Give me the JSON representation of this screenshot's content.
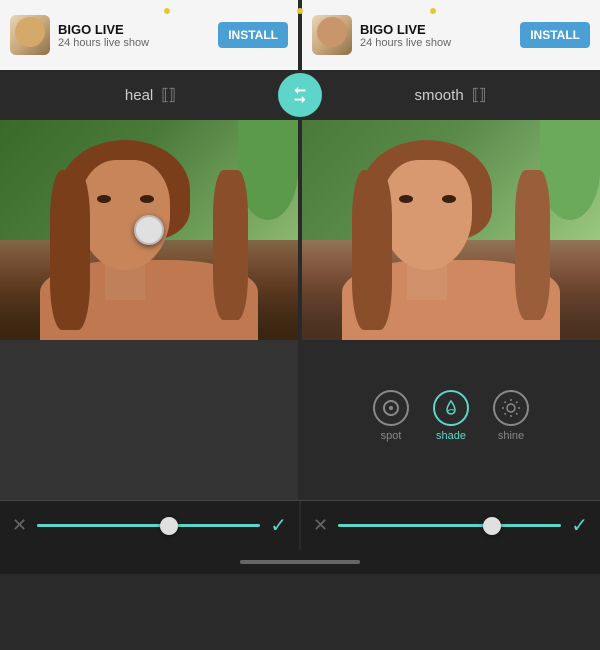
{
  "ads": {
    "left": {
      "title": "BIGO LIVE",
      "subtitle": "24 hours live show",
      "install_label": "INSTALL"
    },
    "right": {
      "title": "BIGO LIVE",
      "subtitle": "24 hours live show",
      "install_label": "INSTALL"
    }
  },
  "filters": {
    "left_label": "heal",
    "right_label": "smooth",
    "toggle_icon": "compare-icon"
  },
  "tools": {
    "items": [
      {
        "id": "spot",
        "label": "spot",
        "active": false
      },
      {
        "id": "shade",
        "label": "shade",
        "active": true
      },
      {
        "id": "shine",
        "label": "shine",
        "active": false
      }
    ]
  },
  "sliders": {
    "left": {
      "cancel_label": "✕",
      "confirm_label": "✓",
      "thumb_position": "55%"
    },
    "right": {
      "cancel_label": "✕",
      "confirm_label": "✓",
      "thumb_position": "65%"
    }
  },
  "dots": {
    "color": "#e8c832"
  }
}
